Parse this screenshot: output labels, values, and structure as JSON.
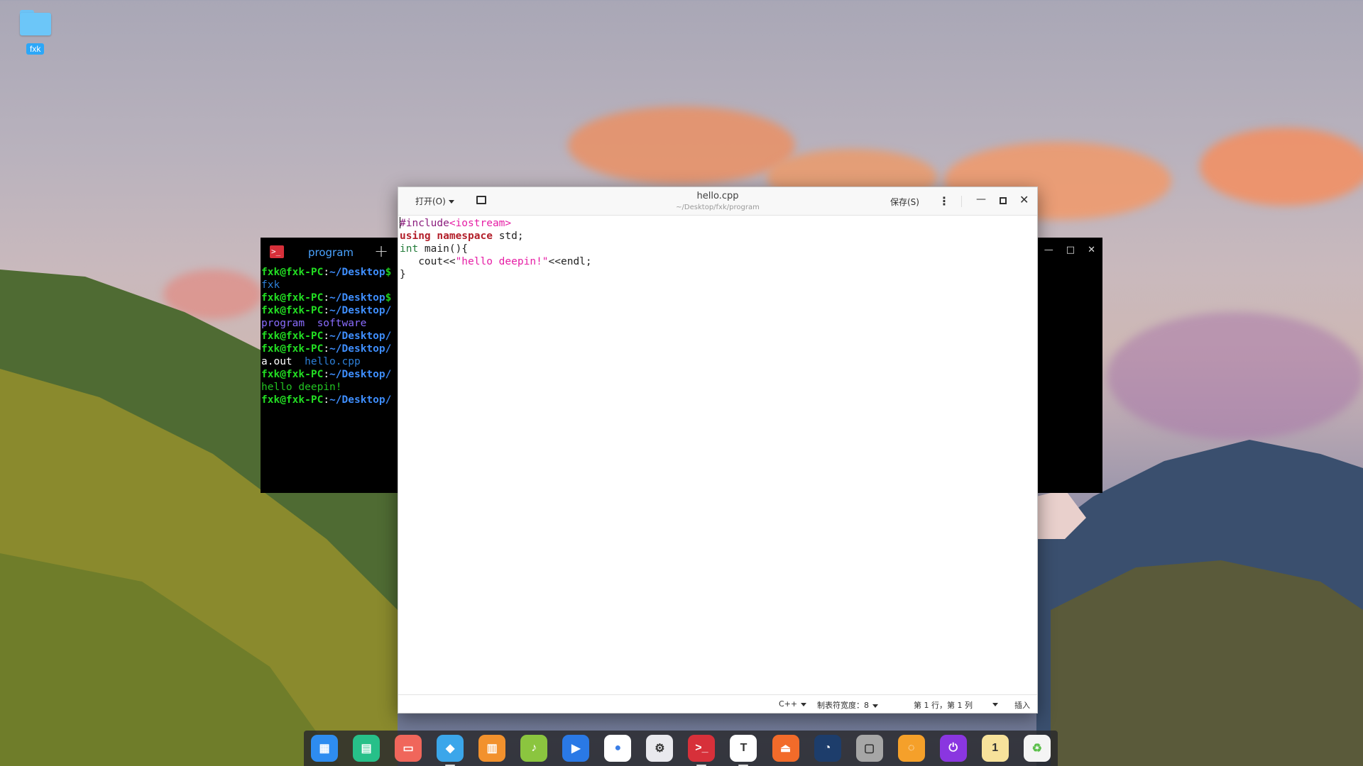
{
  "desktop": {
    "folder_label": "fxk"
  },
  "terminal": {
    "tab_label": "program",
    "icon_glyph": ">_",
    "add_glyph": "+",
    "min_glyph": "—",
    "max_glyph": "□",
    "close_glyph": "✕",
    "lines": [
      [
        {
          "t": "fxk@fxk-PC",
          "c": "t-g"
        },
        {
          "t": ":",
          "c": "t-w"
        },
        {
          "t": "~/Desktop",
          "c": "t-b"
        },
        {
          "t": "$",
          "c": "t-g"
        }
      ],
      [
        {
          "t": "fxk",
          "c": "t-c"
        }
      ],
      [
        {
          "t": "fxk@fxk-PC",
          "c": "t-g"
        },
        {
          "t": ":",
          "c": "t-w"
        },
        {
          "t": "~/Desktop",
          "c": "t-b"
        },
        {
          "t": "$",
          "c": "t-g"
        }
      ],
      [
        {
          "t": "fxk@fxk-PC",
          "c": "t-g"
        },
        {
          "t": ":",
          "c": "t-w"
        },
        {
          "t": "~/Desktop/",
          "c": "t-b"
        }
      ],
      [
        {
          "t": "program  software",
          "c": "t-p"
        }
      ],
      [
        {
          "t": "fxk@fxk-PC",
          "c": "t-g"
        },
        {
          "t": ":",
          "c": "t-w"
        },
        {
          "t": "~/Desktop/",
          "c": "t-b"
        }
      ],
      [
        {
          "t": "fxk@fxk-PC",
          "c": "t-g"
        },
        {
          "t": ":",
          "c": "t-w"
        },
        {
          "t": "~/Desktop/",
          "c": "t-b"
        }
      ],
      [
        {
          "t": "a.out  ",
          "c": "t-w"
        },
        {
          "t": "hello.cpp",
          "c": "t-c"
        }
      ],
      [
        {
          "t": "fxk@fxk-PC",
          "c": "t-g"
        },
        {
          "t": ":",
          "c": "t-w"
        },
        {
          "t": "~/Desktop/",
          "c": "t-b"
        }
      ],
      [
        {
          "t": "hello deepin!",
          "c": "t-grn"
        }
      ],
      [
        {
          "t": "fxk@fxk-PC",
          "c": "t-g"
        },
        {
          "t": ":",
          "c": "t-w"
        },
        {
          "t": "~/Desktop/",
          "c": "t-b"
        }
      ]
    ]
  },
  "editor": {
    "open_label": "打开(O)",
    "title": "hello.cpp",
    "path": "~/Desktop/fxk/program",
    "save_label": "保存(S)",
    "menu_glyph": "⋮",
    "min_glyph": "—",
    "close_glyph": "✕",
    "code": [
      [
        {
          "t": "#include",
          "c": "k-inc"
        },
        {
          "t": "<iostream>",
          "c": "k-str"
        }
      ],
      [
        {
          "t": "using",
          "c": "k-kw"
        },
        {
          "t": " ",
          "c": ""
        },
        {
          "t": "namespace",
          "c": "k-kw"
        },
        {
          "t": " std;",
          "c": ""
        }
      ],
      [
        {
          "t": "int",
          "c": "k-int"
        },
        {
          "t": " main(){",
          "c": ""
        }
      ],
      [
        {
          "t": "   cout<<",
          "c": ""
        },
        {
          "t": "\"hello deepin!\"",
          "c": "k-str"
        },
        {
          "t": "<<endl;",
          "c": ""
        }
      ],
      [
        {
          "t": "}",
          "c": ""
        }
      ]
    ],
    "status": {
      "language": "C++",
      "tab_width": "制表符宽度：8",
      "position": "第 1 行，第 1 列",
      "mode": "插入"
    }
  },
  "dock": {
    "items": [
      {
        "name": "launcher-icon",
        "bg": "#2e8cf0",
        "glyph": "▦"
      },
      {
        "name": "file-manager-icon",
        "bg": "#27c089",
        "glyph": "▤"
      },
      {
        "name": "screen-recorder-icon",
        "bg": "#f0665b",
        "glyph": "▭"
      },
      {
        "name": "app-store-icon",
        "bg": "#3ba6ea",
        "glyph": "◆"
      },
      {
        "name": "deepin-store-icon",
        "bg": "#f2912d",
        "glyph": "▥"
      },
      {
        "name": "music-icon",
        "bg": "#8bc53f",
        "glyph": "♪"
      },
      {
        "name": "movie-icon",
        "bg": "#2a79e6",
        "glyph": "▶"
      },
      {
        "name": "chrome-icon",
        "bg": "#ffffff",
        "glyph": "●"
      },
      {
        "name": "settings-icon",
        "bg": "#e9e9ee",
        "glyph": "⚙"
      },
      {
        "name": "terminal-icon",
        "bg": "#d7303a",
        "glyph": ">_"
      },
      {
        "name": "text-editor-icon",
        "bg": "#ffffff",
        "glyph": "T"
      },
      {
        "name": "upload-icon",
        "bg": "#f26b2a",
        "glyph": "⏏"
      },
      {
        "name": "deepin-clone-icon",
        "bg": "#1d3d6b",
        "glyph": "◔"
      },
      {
        "name": "archive-icon",
        "bg": "#a6a6a6",
        "glyph": "▢"
      },
      {
        "name": "search-app-icon",
        "bg": "#f5a02a",
        "glyph": "◌"
      },
      {
        "name": "power-icon",
        "bg": "#8a36e0",
        "glyph": "⏻"
      },
      {
        "name": "clock-icon",
        "bg": "#f7e29b",
        "glyph": "1"
      },
      {
        "name": "trash-icon",
        "bg": "#f4f4f4",
        "glyph": "♻"
      }
    ],
    "active_indices": [
      3,
      9,
      10
    ]
  }
}
